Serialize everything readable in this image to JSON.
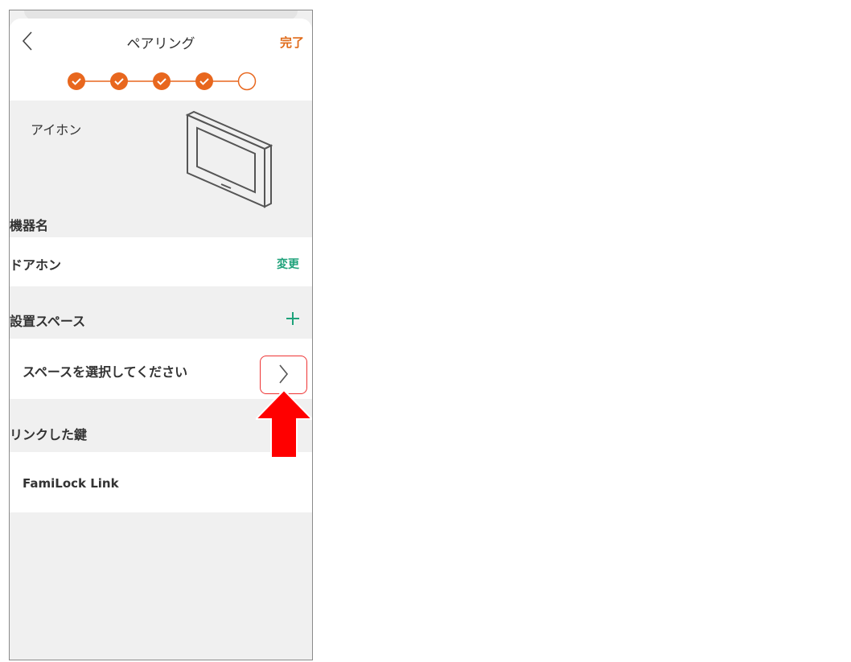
{
  "header": {
    "title": "ペアリング",
    "done_label": "完了"
  },
  "stepper": {
    "total_steps": 5,
    "completed_steps": 4,
    "accent_color": "#E8671E"
  },
  "device": {
    "type_label": "アイホン",
    "illustration_icon": "intercom-monitor-icon"
  },
  "device_name": {
    "section_label": "機器名",
    "value": "ドアホン",
    "change_label": "変更",
    "change_color": "#1EA27A"
  },
  "install_space": {
    "section_label": "設置スペース",
    "add_icon": "plus-icon",
    "select_prompt": "スペースを選択してください",
    "chevron_icon": "chevron-right-icon"
  },
  "linked_lock": {
    "section_label": "リンクした鍵",
    "value": "FamiLock Link"
  },
  "annotation": {
    "arrow_color": "#FF0000",
    "highlight_border_color": "#E33333"
  }
}
